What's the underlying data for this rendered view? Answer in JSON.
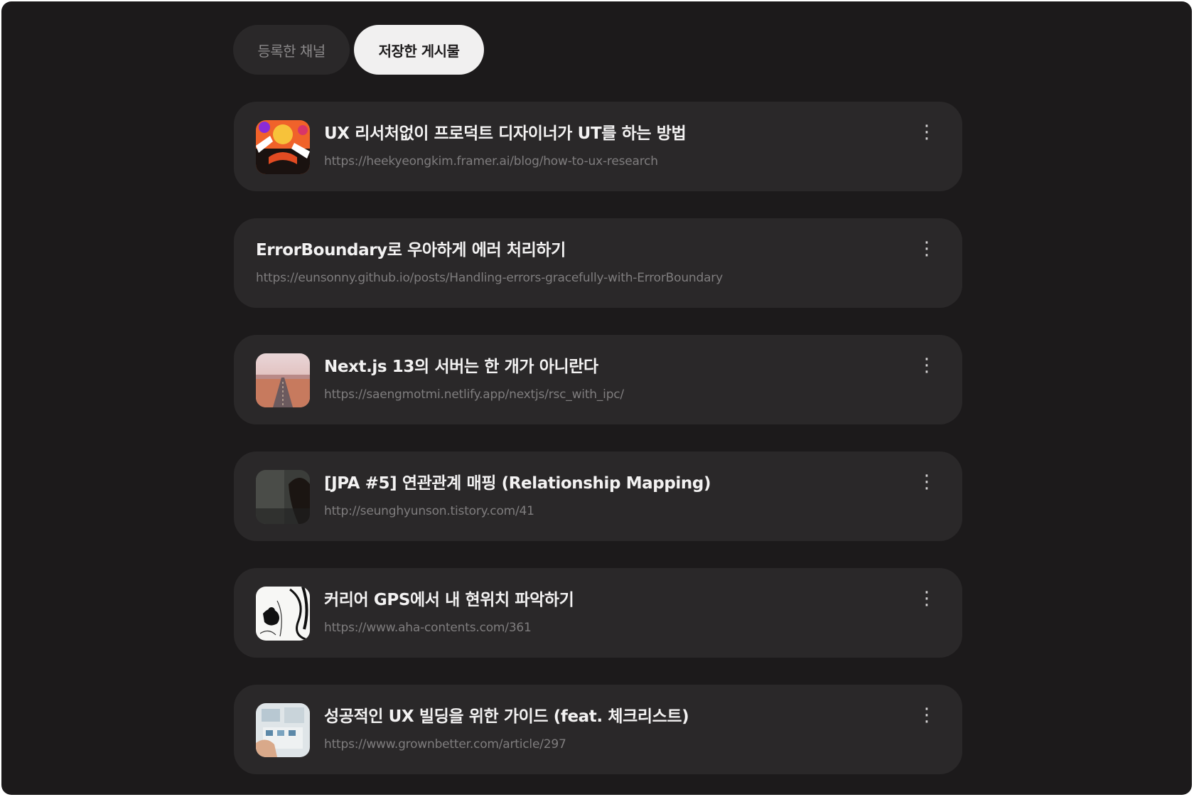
{
  "tabs": [
    {
      "label": "등록한 채널",
      "active": false
    },
    {
      "label": "저장한 게시물",
      "active": true
    }
  ],
  "more_icon": "more-vertical-icon",
  "more_glyph": "⋮",
  "posts": [
    {
      "title": "UX 리서처없이 프로덕트 디자이너가 UT를 하는 방법",
      "url": "https://heekyeongkim.framer.ai/blog/how-to-ux-research"
    },
    {
      "title": "ErrorBoundary로 우아하게 에러 처리하기",
      "url": "https://eunsonny.github.io/posts/Handling-errors-gracefully-with-ErrorBoundary"
    },
    {
      "title": "Next.js 13의 서버는 한 개가 아니란다",
      "url": "https://saengmotmi.netlify.app/nextjs/rsc_with_ipc/"
    },
    {
      "title": "[JPA #5] 연관관계 매핑 (Relationship Mapping)",
      "url": "http://seunghyunson.tistory.com/41"
    },
    {
      "title": "커리어 GPS에서 내 현위치 파악하기",
      "url": "https://www.aha-contents.com/361"
    },
    {
      "title": "성공적인 UX 빌딩을 위한 가이드 (feat. 체크리스트)",
      "url": "https://www.grownbetter.com/article/297"
    }
  ]
}
